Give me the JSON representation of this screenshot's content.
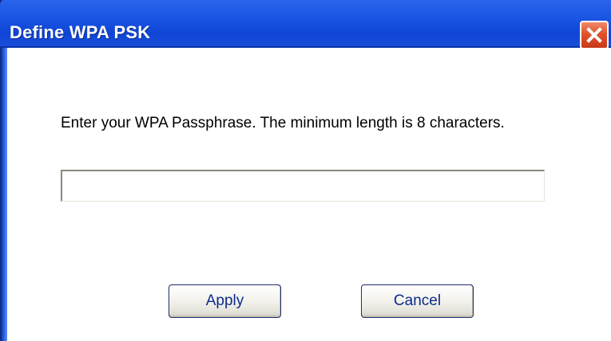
{
  "window": {
    "title": "Define WPA PSK",
    "close_icon": "close-icon"
  },
  "dialog": {
    "prompt": "Enter your WPA Passphrase.  The minimum length is 8 characters.",
    "passphrase_value": "",
    "passphrase_placeholder": ""
  },
  "buttons": {
    "apply_label": "Apply",
    "cancel_label": "Cancel"
  },
  "colors": {
    "titlebar": "#1b56e4",
    "close_button": "#e0532b",
    "button_text": "#0d2b8c"
  }
}
